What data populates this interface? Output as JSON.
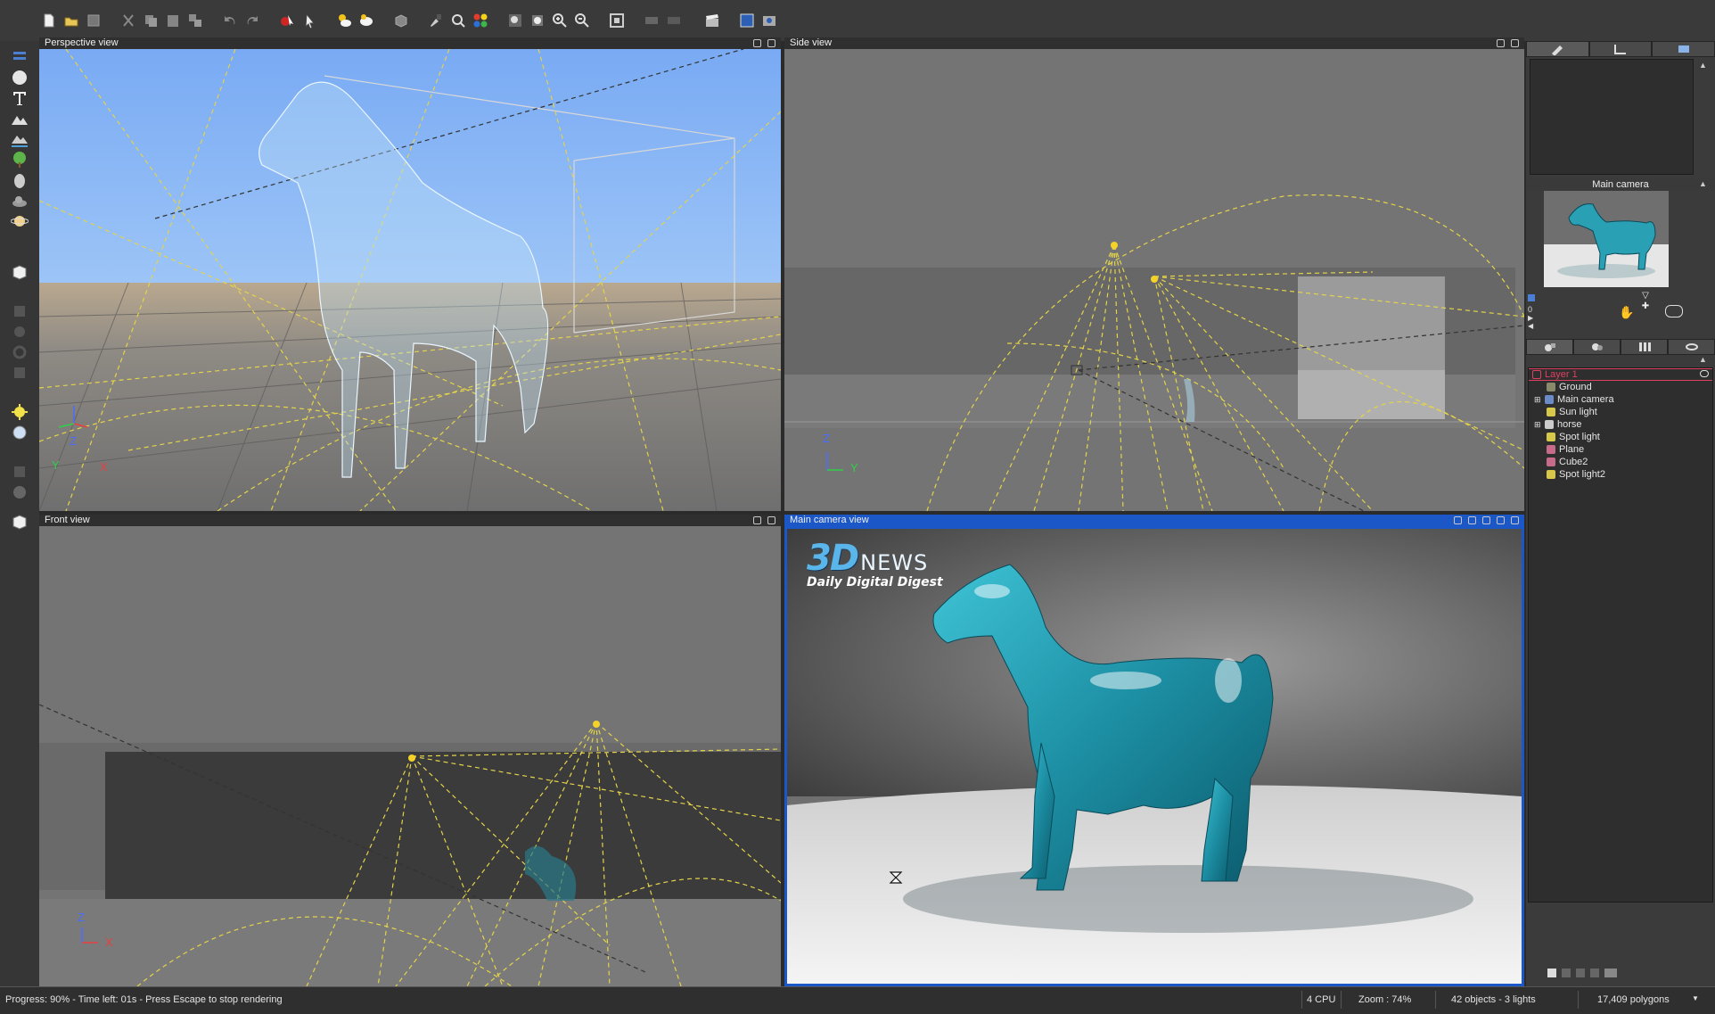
{
  "viewports": {
    "perspective": {
      "title": "Perspective view",
      "axes": {
        "z": "Z",
        "y": "Y",
        "x": "X"
      }
    },
    "side": {
      "title": "Side view",
      "axes": {
        "z": "Z",
        "y": "Y"
      }
    },
    "front": {
      "title": "Front view",
      "axes": {
        "z": "Z",
        "x": "X"
      }
    },
    "camera": {
      "title": "Main camera view"
    }
  },
  "watermark": {
    "brand_3d": "3D",
    "brand_news": "NEWS",
    "tagline": "Daily Digital Digest"
  },
  "right_panel": {
    "preview_title": "Main camera",
    "tree": [
      {
        "label": "Layer 1",
        "icon": "layer-icon"
      },
      {
        "label": "Ground",
        "icon": "ground-icon"
      },
      {
        "label": "Main camera",
        "icon": "camera-icon"
      },
      {
        "label": "Sun light",
        "icon": "light-icon"
      },
      {
        "label": "horse",
        "icon": "mesh-icon"
      },
      {
        "label": "Spot light",
        "icon": "spotlight-icon"
      },
      {
        "label": "Plane",
        "icon": "plane-icon"
      },
      {
        "label": "Cube2",
        "icon": "cube-icon"
      },
      {
        "label": "Spot light2",
        "icon": "spotlight-icon"
      }
    ],
    "side_controls": [
      "0"
    ]
  },
  "status": {
    "progress": "Progress: 90% - Time left: 01s - Press Escape to stop rendering",
    "cpu": "4 CPU",
    "zoom": "Zoom : 74%",
    "objects": "42 objects - 3 lights",
    "polygons": "17,409 polygons"
  },
  "colors": {
    "sky": "#7fb0f5",
    "active_header": "#1b57c7",
    "horse_teal": "#2aa0b5",
    "light_lines": "#e2d24a",
    "tree_highlight": "#e04060"
  }
}
